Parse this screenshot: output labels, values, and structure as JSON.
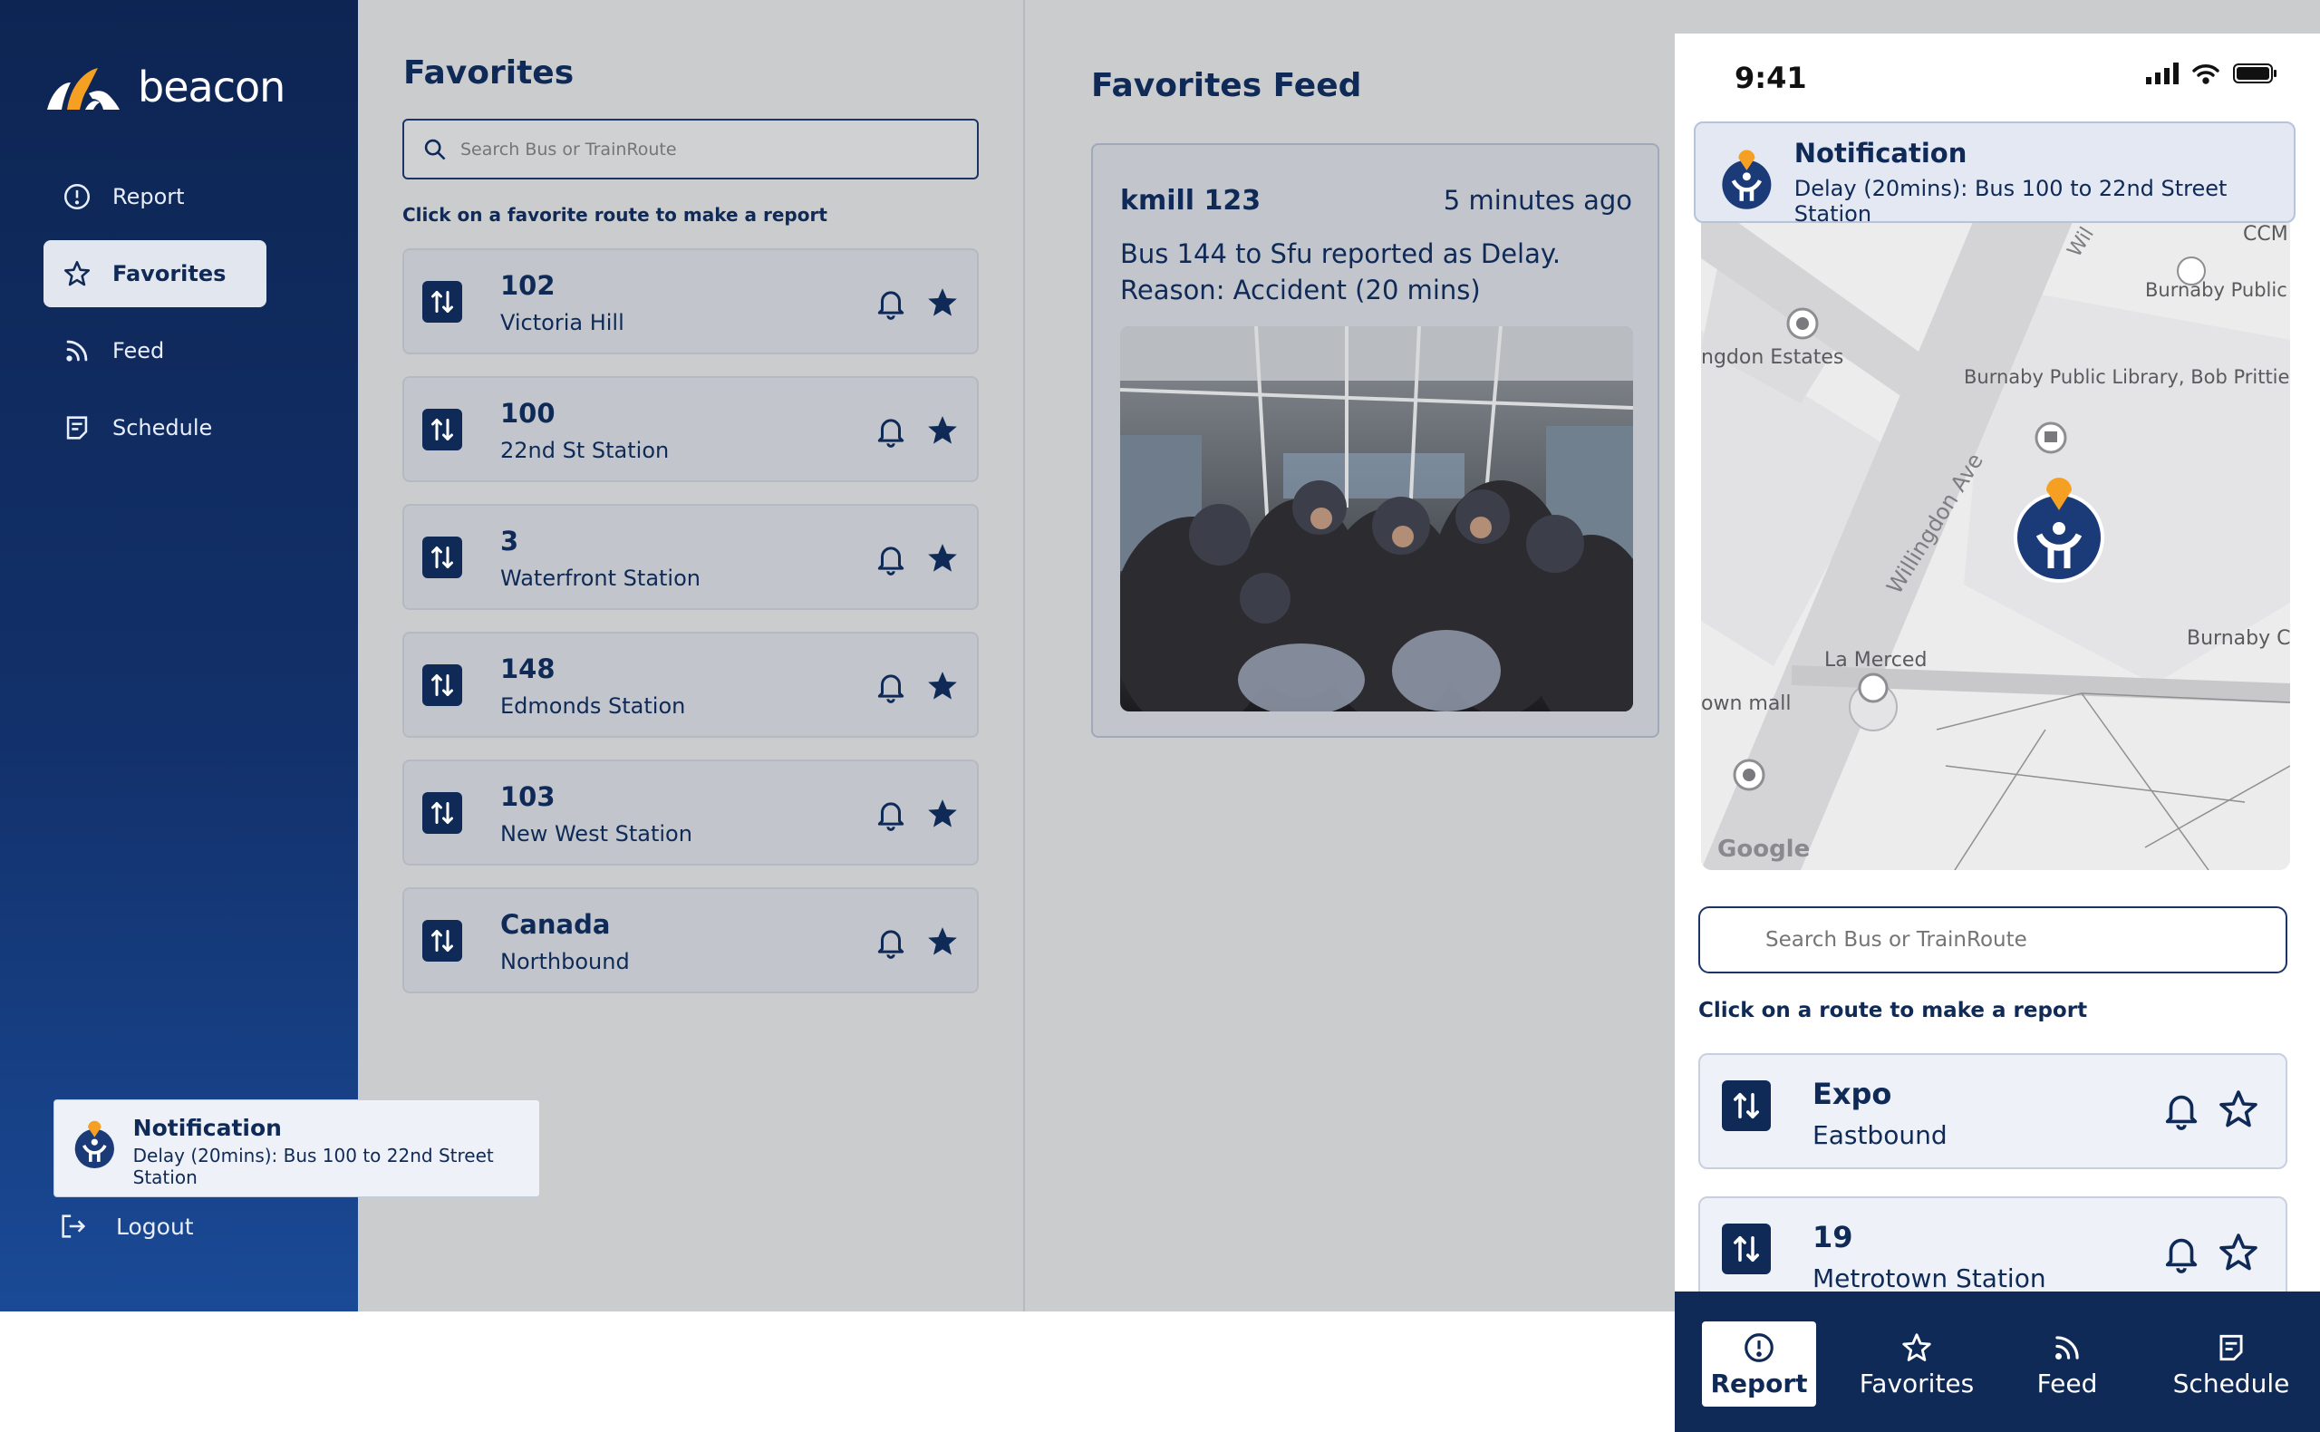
{
  "brand": {
    "name": "beacon"
  },
  "sidebar": {
    "items": [
      {
        "label": "Report",
        "icon": "alert-circle-icon"
      },
      {
        "label": "Favorites",
        "icon": "star-icon",
        "active": true
      },
      {
        "label": "Feed",
        "icon": "rss-icon"
      },
      {
        "label": "Schedule",
        "icon": "schedule-icon"
      }
    ],
    "logout_label": "Logout"
  },
  "notification": {
    "title": "Notification",
    "body": "Delay (20mins): Bus 100 to 22nd Street Station"
  },
  "favorites": {
    "title": "Favorites",
    "search_placeholder": "Search Bus or TrainRoute",
    "hint": "Click on a favorite route to make a report",
    "routes": [
      {
        "number": "102",
        "destination": "Victoria Hill"
      },
      {
        "number": "100",
        "destination": "22nd St Station"
      },
      {
        "number": "3",
        "destination": "Waterfront Station"
      },
      {
        "number": "148",
        "destination": "Edmonds Station"
      },
      {
        "number": "103",
        "destination": "New West Station"
      },
      {
        "number": "Canada",
        "destination": "Northbound"
      }
    ]
  },
  "feed": {
    "title": "Favorites Feed",
    "post": {
      "user": "kmill 123",
      "time": "5 minutes ago",
      "text": "Bus 144 to Sfu reported as Delay. Reason: Accident (20 mins)"
    }
  },
  "phone": {
    "status_time": "9:41",
    "map_labels": {
      "ccm": "CCM",
      "library_parking": "Burnaby Public Library Parking",
      "estates": "ngdon Estates",
      "library": "Burnaby Public Library, Bob Prittie...",
      "street": "Willingdon Ave",
      "civic": "Burnaby Civic Squa",
      "la_merced": "La Merced",
      "mall": "own mall",
      "google": "Google",
      "road_top": "Wil"
    },
    "search_placeholder": "Search Bus or TrainRoute",
    "hint": "Click on a route to make a report",
    "routes": [
      {
        "number": "Expo",
        "destination": "Eastbound"
      },
      {
        "number": "19",
        "destination": "Metrotown Station"
      }
    ],
    "tabs": [
      {
        "label": "Report",
        "active": true
      },
      {
        "label": "Favorites"
      },
      {
        "label": "Feed"
      },
      {
        "label": "Schedule"
      }
    ]
  },
  "colors": {
    "navy": "#0f2a57",
    "orange": "#f5a023",
    "sidebar": "#12306a",
    "panel": "#cbccce"
  }
}
